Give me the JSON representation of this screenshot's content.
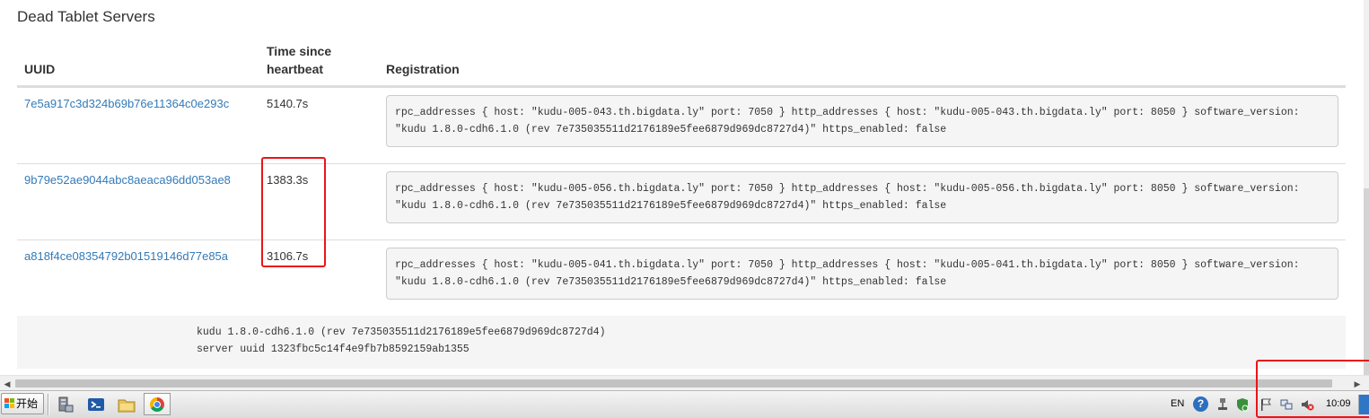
{
  "section": {
    "title": "Dead Tablet Servers"
  },
  "table": {
    "headers": {
      "uuid": "UUID",
      "time": "Time since heartbeat",
      "registration": "Registration"
    },
    "rows": [
      {
        "uuid": "7e5a917c3d324b69b76e11364c0e293c",
        "time": "5140.7s",
        "registration": "rpc_addresses { host: \"kudu-005-043.th.bigdata.ly\" port: 7050 } http_addresses { host: \"kudu-005-043.th.bigdata.ly\" port: 8050 } software_version: \"kudu 1.8.0-cdh6.1.0 (rev 7e735035511d2176189e5fee6879d969dc8727d4)\" https_enabled: false"
      },
      {
        "uuid": "9b79e52ae9044abc8aeaca96dd053ae8",
        "time": "1383.3s",
        "registration": "rpc_addresses { host: \"kudu-005-056.th.bigdata.ly\" port: 7050 } http_addresses { host: \"kudu-005-056.th.bigdata.ly\" port: 8050 } software_version: \"kudu 1.8.0-cdh6.1.0 (rev 7e735035511d2176189e5fee6879d969dc8727d4)\" https_enabled: false"
      },
      {
        "uuid": "a818f4ce08354792b01519146d77e85a",
        "time": "3106.7s",
        "registration": "rpc_addresses { host: \"kudu-005-041.th.bigdata.ly\" port: 7050 } http_addresses { host: \"kudu-005-041.th.bigdata.ly\" port: 8050 } software_version: \"kudu 1.8.0-cdh6.1.0 (rev 7e735035511d2176189e5fee6879d969dc8727d4)\" https_enabled: false"
      }
    ]
  },
  "footer": {
    "version": "kudu 1.8.0-cdh6.1.0 (rev 7e735035511d2176189e5fee6879d969dc8727d4)",
    "server_uuid": "server uuid 1323fbc5c14f4e9fb7b8592159ab1355"
  },
  "taskbar": {
    "start_label": "开始",
    "language": "EN",
    "help": "?",
    "clock": "10:09",
    "icons": [
      "server-manager-icon",
      "powershell-icon",
      "explorer-folder-icon",
      "chrome-icon"
    ]
  },
  "colors": {
    "link": "#337ab7",
    "highlight": "#e8161b",
    "pre_bg": "#f5f5f5"
  }
}
